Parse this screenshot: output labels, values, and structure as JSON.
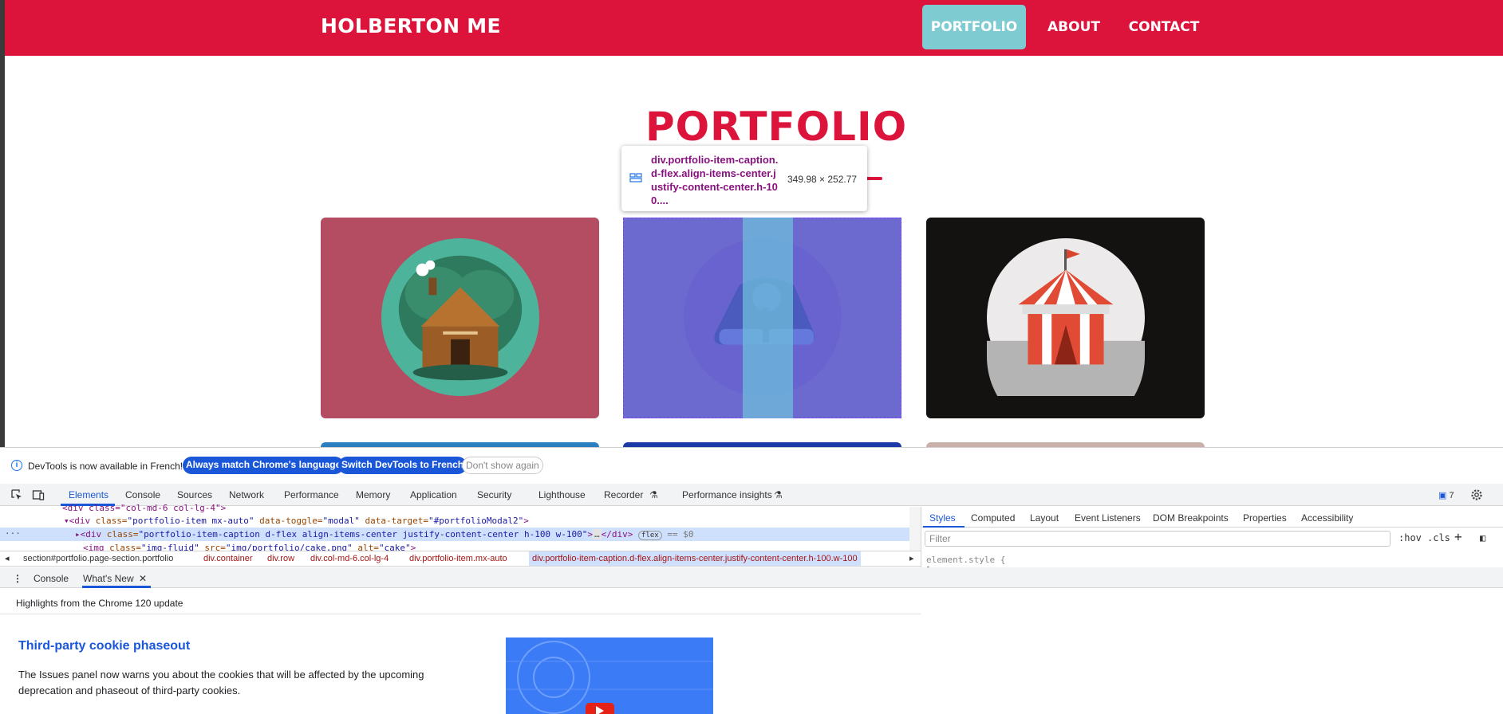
{
  "site": {
    "brand": "HOLBERTON ME",
    "nav": [
      "PORTFOLIO",
      "ABOUT",
      "CONTACT"
    ],
    "section_title": "PORTFOLIO",
    "cards": [
      {
        "name": "log-cabin"
      },
      {
        "name": "cake"
      },
      {
        "name": "circus-tent"
      }
    ],
    "colors": {
      "brand": "#dc143c",
      "nav_active": "#7ecbd2"
    }
  },
  "tooltip": {
    "selector": "div.portfolio-item-caption.d-flex.align-items-center.justify-content-center.h-100....",
    "size": "349.98 × 252.77"
  },
  "devtools": {
    "infobar": {
      "text": "DevTools is now available in French!",
      "btn_match": "Always match Chrome's language",
      "btn_switch": "Switch DevTools to French",
      "btn_dont": "Don't show again"
    },
    "tabs": [
      "Elements",
      "Console",
      "Sources",
      "Network",
      "Performance",
      "Memory",
      "Application",
      "Security",
      "Lighthouse",
      "Recorder",
      "Performance insights"
    ],
    "issues_count": "7",
    "elements_lines": [
      {
        "pre": "<div class=\"col-md-6 col-lg-4\">"
      },
      {
        "tag": "<div ",
        "a1n": "class=",
        "a1v": "\"portfolio-item mx-auto\"",
        "a2n": " data-toggle=",
        "a2v": "\"modal\"",
        "a3n": " data-target=",
        "a3v": "\"#portfolioModal2\"",
        "end": ">"
      },
      {
        "tag": "<div ",
        "a1n": "class=",
        "a1v": "\"portfolio-item-caption d-flex align-items-center justify-content-center h-100 w-100\"",
        "end": ">",
        "mid": "…",
        "close": "</div>",
        "badge": "flex",
        "eq": "== $0"
      },
      {
        "tag": "<img ",
        "a1n": "class=",
        "a1v": "\"img-fluid\"",
        "a2n": " src=",
        "a2v": "img/portfolio/cake.png",
        "a3n": " alt=",
        "a3v": "\"cake\"",
        "end": ">"
      }
    ],
    "breadcrumbs": [
      "section#portfolio.page-section.portfolio",
      "div.container",
      "div.row",
      "div.col-md-6.col-lg-4",
      "div.portfolio-item.mx-auto",
      "div.portfolio-item-caption.d-flex.align-items-center.justify-content-center.h-100.w-100"
    ],
    "styles_tabs": [
      "Styles",
      "Computed",
      "Layout",
      "Event Listeners",
      "DOM Breakpoints",
      "Properties",
      "Accessibility"
    ],
    "filter_placeholder": "Filter",
    "hov": ":hov",
    "cls": ".cls",
    "element_style": "element.style {",
    "element_style_close": "}",
    "drawer_tabs": [
      "Console",
      "What's New"
    ],
    "highlights": "Highlights from the Chrome 120 update",
    "article_title": "Third-party cookie phaseout",
    "article_body": "The Issues panel now warns you about the cookies that will be affected by the upcoming deprecation and phaseout of third-party cookies."
  }
}
